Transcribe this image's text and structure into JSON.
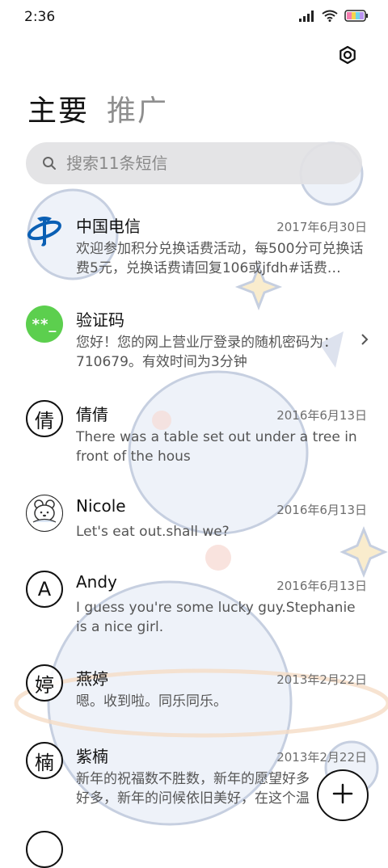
{
  "status_bar": {
    "time": "2:36"
  },
  "tabs": [
    {
      "label": "主要",
      "active": true
    },
    {
      "label": "推广",
      "active": false
    }
  ],
  "search": {
    "placeholder": "搜索11条短信"
  },
  "conversations": [
    {
      "name": "中国电信",
      "date": "2017年6月30日",
      "preview": "欢迎参加积分兑换话费活动，每500分可兑换话费5元，兑换话费请回复106或jfdh#话费…",
      "avatar": "china-telecom-logo"
    },
    {
      "name": "验证码",
      "date": "",
      "preview": "您好！您的网上营业厅登录的随机密码为：710679。有效时间为3分钟",
      "avatar_text": "**_"
    },
    {
      "name": "倩倩",
      "date": "2016年6月13日",
      "preview": "There was a table set out under a tree in front of the hous",
      "avatar_text": "倩"
    },
    {
      "name": "Nicole",
      "date": "2016年6月13日",
      "preview": "Let's eat out.shall we?",
      "avatar": "cartoon-bear"
    },
    {
      "name": "Andy",
      "date": "2016年6月13日",
      "preview": "I guess you're some lucky guy.Stephanie is a nice girl.",
      "avatar_text": "A"
    },
    {
      "name": "燕婷",
      "date": "2013年2月22日",
      "preview": "嗯。收到啦。同乐同乐。",
      "avatar_text": "婷"
    },
    {
      "name": "紫楠",
      "date": "2013年2月22日",
      "preview": "新年的祝福数不胜数，新年的愿望好多好多，新年的问候依旧美好，在这个温馨的时刻",
      "avatar_text": "楠"
    }
  ],
  "colors": {
    "accent_green": "#5ccf4e",
    "telecom_blue": "#0a5fb4"
  }
}
